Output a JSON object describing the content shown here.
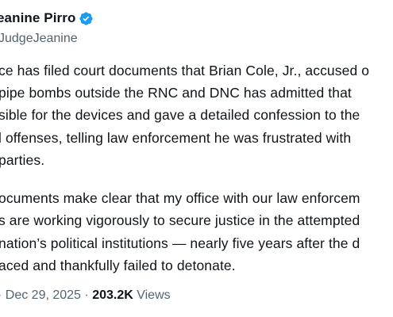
{
  "author": {
    "display_name": "eanine Pirro",
    "handle": "JudgeJeanine",
    "verified_icon": "verified-badge-icon",
    "verified_color": "#1d9bf0"
  },
  "tweet": {
    "lines": [
      "ce has filed court documents that Brian Cole, Jr., accused o",
      "pipe bombs outside the RNC and DNC has admitted that",
      "sible for the devices and gave a detailed confession to the",
      "l offenses, telling law enforcement he was frustrated with",
      " parties.",
      "ocuments make clear that my office with our law enforcem",
      "s are working vigorously to secure justice in the attempted",
      "nation’s political institutions — nearly five years after the d",
      "aced and thankfully failed to detonate."
    ]
  },
  "meta": {
    "prefix": "· Dec 29, 2025 ·",
    "views_count": "203.2K",
    "views_label": "Views"
  }
}
